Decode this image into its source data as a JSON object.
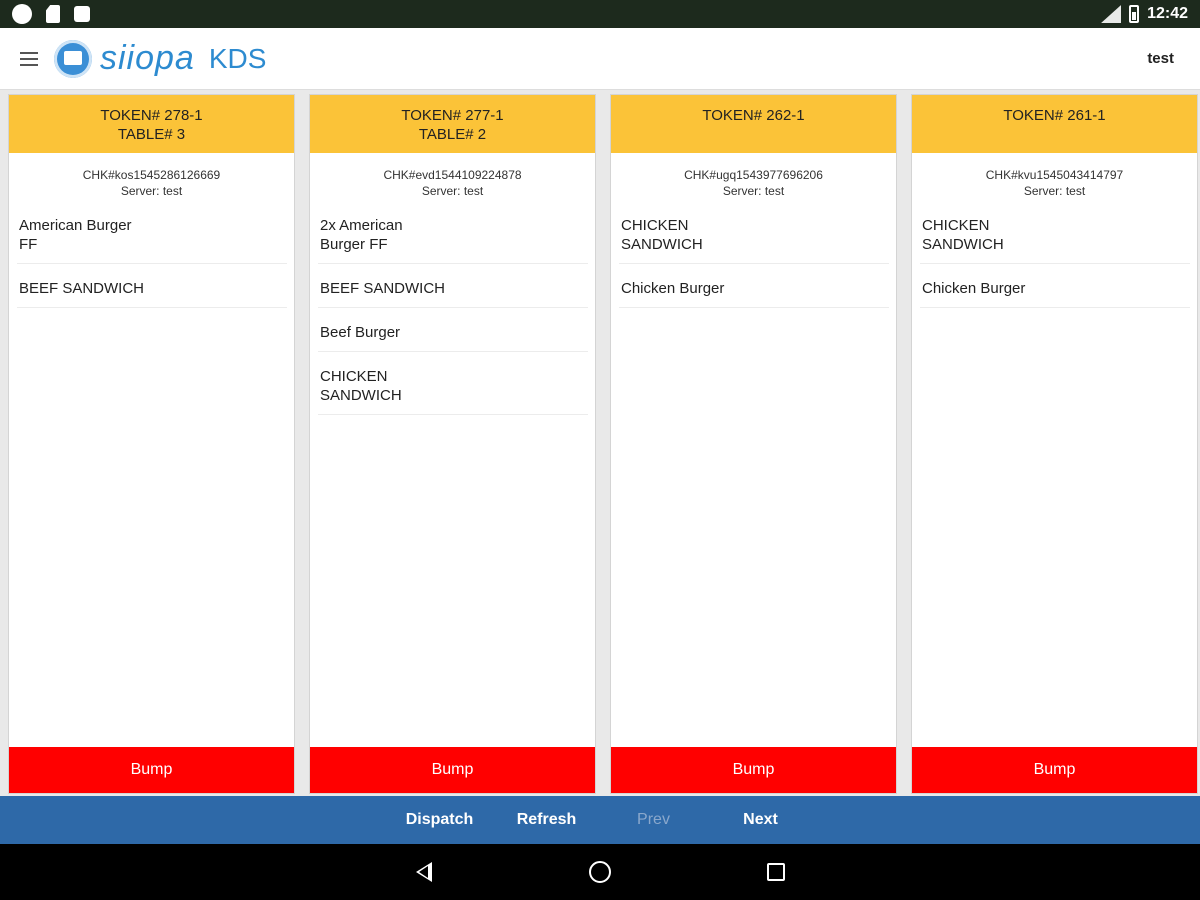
{
  "status_bar": {
    "time": "12:42"
  },
  "app": {
    "logo_text": "siiopa",
    "logo_suffix": "KDS",
    "username": "test"
  },
  "orders": [
    {
      "token": "TOKEN# 278-1",
      "table": "TABLE# 3",
      "check": "CHK#kos1545286126669",
      "server": "Server: test",
      "items": [
        "American Burger\nFF",
        "BEEF SANDWICH"
      ],
      "bump_label": "Bump"
    },
    {
      "token": "TOKEN# 277-1",
      "table": "TABLE# 2",
      "check": "CHK#evd1544109224878",
      "server": "Server: test",
      "items": [
        "2x American\nBurger FF",
        "BEEF SANDWICH",
        "Beef Burger",
        "CHICKEN\nSANDWICH"
      ],
      "bump_label": "Bump"
    },
    {
      "token": "TOKEN# 262-1",
      "table": "",
      "check": "CHK#ugq1543977696206",
      "server": "Server: test",
      "items": [
        "CHICKEN\nSANDWICH",
        "Chicken Burger"
      ],
      "bump_label": "Bump"
    },
    {
      "token": "TOKEN# 261-1",
      "table": "",
      "check": "CHK#kvu1545043414797",
      "server": "Server: test",
      "items": [
        "CHICKEN\nSANDWICH",
        "Chicken Burger"
      ],
      "bump_label": "Bump"
    }
  ],
  "actions": {
    "dispatch": "Dispatch",
    "refresh": "Refresh",
    "prev": "Prev",
    "next": "Next"
  },
  "colors": {
    "header_yellow": "#fbc338",
    "bump_red": "#ff0000",
    "action_bar_blue": "#2e69a8",
    "brand_blue": "#2d8bd0"
  },
  "icons": {
    "menu": "hamburger-menu-icon",
    "nav_back": "back-triangle-icon",
    "nav_home": "home-circle-icon",
    "nav_recent": "recent-square-icon"
  }
}
